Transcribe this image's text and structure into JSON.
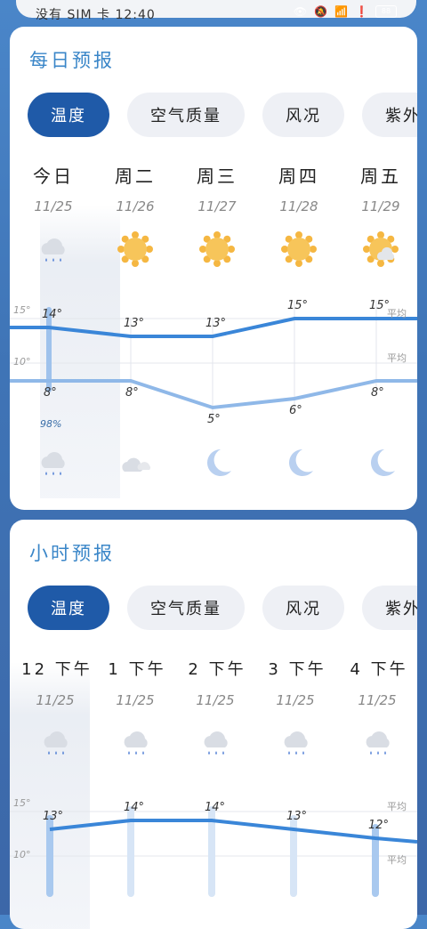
{
  "status": {
    "text": "没有 SIM 卡 12:40",
    "battery": "88"
  },
  "daily": {
    "title": "每日预报",
    "tabs": [
      "温度",
      "空气质量",
      "风况",
      "紫外线"
    ],
    "days": [
      {
        "label": "今日",
        "date": "11/25",
        "day_icon": "rain-cloud-icon",
        "high": "14°",
        "low": "8°",
        "precip": "98%",
        "night_icon": "rain-cloud-icon"
      },
      {
        "label": "周二",
        "date": "11/26",
        "day_icon": "sun-icon",
        "high": "13°",
        "low": "8°",
        "precip": "",
        "night_icon": "cloud-moon-icon"
      },
      {
        "label": "周三",
        "date": "11/27",
        "day_icon": "sun-icon",
        "high": "13°",
        "low": "5°",
        "precip": "",
        "night_icon": "moon-icon"
      },
      {
        "label": "周四",
        "date": "11/28",
        "day_icon": "sun-icon",
        "high": "15°",
        "low": "6°",
        "precip": "",
        "night_icon": "moon-icon"
      },
      {
        "label": "周五",
        "date": "11/29",
        "day_icon": "sun-cloud-icon",
        "high": "15°",
        "low": "8°",
        "precip": "",
        "night_icon": "moon-icon"
      }
    ],
    "axis_high": "15°",
    "axis_low": "10°",
    "avg_label": "平均",
    "highs": [
      14,
      13,
      13,
      15,
      15
    ],
    "lows": [
      8,
      8,
      5,
      6,
      8
    ]
  },
  "hourly": {
    "title": "小时预报",
    "tabs": [
      "温度",
      "空气质量",
      "风况",
      "紫外线"
    ],
    "hours": [
      {
        "label": "12 下午",
        "date": "11/25",
        "icon": "rain-cloud-icon",
        "temp": "13°"
      },
      {
        "label": "1 下午",
        "date": "11/25",
        "icon": "rain-cloud-icon",
        "temp": "14°"
      },
      {
        "label": "2 下午",
        "date": "11/25",
        "icon": "rain-cloud-icon",
        "temp": "14°"
      },
      {
        "label": "3 下午",
        "date": "11/25",
        "icon": "rain-cloud-icon",
        "temp": "13°"
      },
      {
        "label": "4 下午",
        "date": "11/25",
        "icon": "rain-cloud-icon",
        "temp": "12°"
      }
    ],
    "axis_high": "15°",
    "axis_low": "10°",
    "avg_label": "平均",
    "temps": [
      13,
      14,
      14,
      13,
      12
    ]
  },
  "colors": {
    "accent": "#1f5aa8",
    "line": "#3a86d8",
    "title": "#3a86c8"
  }
}
